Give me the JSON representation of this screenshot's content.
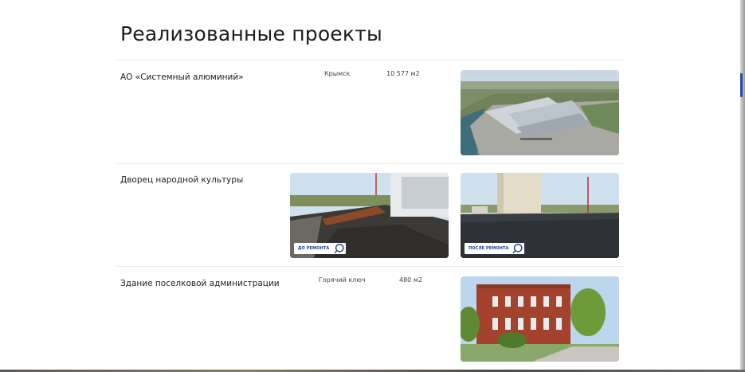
{
  "page": {
    "title": "Реализованные проекты"
  },
  "projects": [
    {
      "name": "АО «Системный алюминий»",
      "city": "Крымск",
      "area": "10 577 м2"
    },
    {
      "name": "Дворец народной культуры",
      "before_label": "ДО РЕМОНТА",
      "after_label": "ПОСЛЕ РЕМОНТА",
      "zoom_icon": "zoom-icon"
    },
    {
      "name": "Здание поселковой администрации",
      "city": "Горячий ключ",
      "area": "480 м2"
    }
  ],
  "colors": {
    "accent": "#1f4da8",
    "badge_text": "#1a3c8a"
  }
}
